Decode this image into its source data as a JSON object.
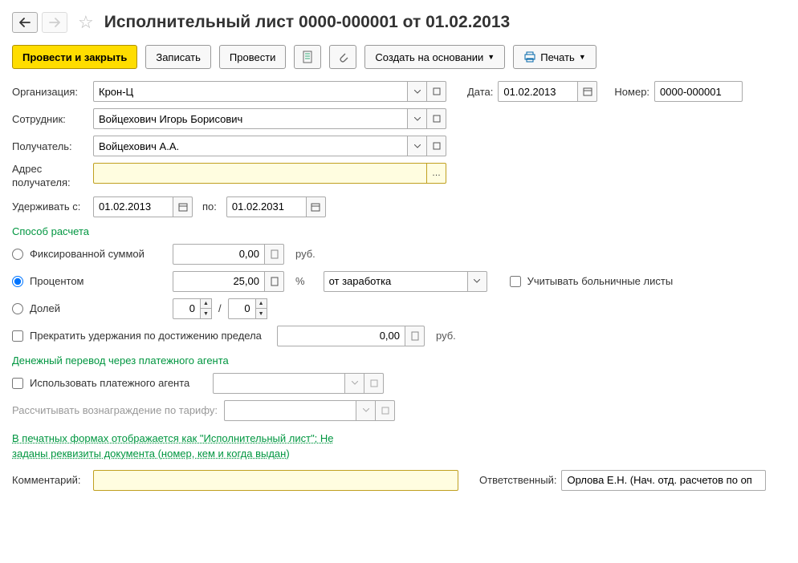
{
  "header": {
    "title": "Исполнительный лист 0000-000001 от 01.02.2013"
  },
  "toolbar": {
    "post_close": "Провести и закрыть",
    "save": "Записать",
    "post": "Провести",
    "create_based": "Создать на основании",
    "print": "Печать"
  },
  "fields": {
    "org_label": "Организация:",
    "org_value": "Крон-Ц",
    "date_label": "Дата:",
    "date_value": "01.02.2013",
    "number_label": "Номер:",
    "number_value": "0000-000001",
    "employee_label": "Сотрудник:",
    "employee_value": "Войцехович Игорь Борисович",
    "recipient_label": "Получатель:",
    "recipient_value": "Войцехович А.А.",
    "address_label": "Адрес получателя:",
    "address_value": "",
    "decline": "…",
    "withhold_from_label": "Удерживать с:",
    "withhold_from": "01.02.2013",
    "withhold_to_label": "по:",
    "withhold_to": "01.02.2031"
  },
  "calc": {
    "header": "Способ расчета",
    "fixed": "Фиксированной суммой",
    "fixed_value": "0,00",
    "percent": "Процентом",
    "percent_value": "25,00",
    "percent_unit": "%",
    "base": "от заработка",
    "sick_leave": "Учитывать больничные листы",
    "share": "Долей",
    "share_num": "0",
    "share_den": "0",
    "slash": "/",
    "stop_limit": "Прекратить удержания по достижению предела",
    "limit_value": "0,00",
    "rub": "руб."
  },
  "transfer": {
    "header": "Денежный перевод через платежного агента",
    "use_agent": "Использовать платежного агента",
    "tariff_label": "Рассчитывать вознаграждение по тарифу:"
  },
  "footer": {
    "print_as_1": "В печатных формах отображается как \"Исполнительный лист\"; Не",
    "print_as_2": "заданы реквизиты документа (номер, кем и когда выдан)",
    "comment_label": "Комментарий:",
    "comment_value": "",
    "responsible_label": "Ответственный:",
    "responsible_value": "Орлова Е.Н. (Нач. отд. расчетов по оп"
  }
}
